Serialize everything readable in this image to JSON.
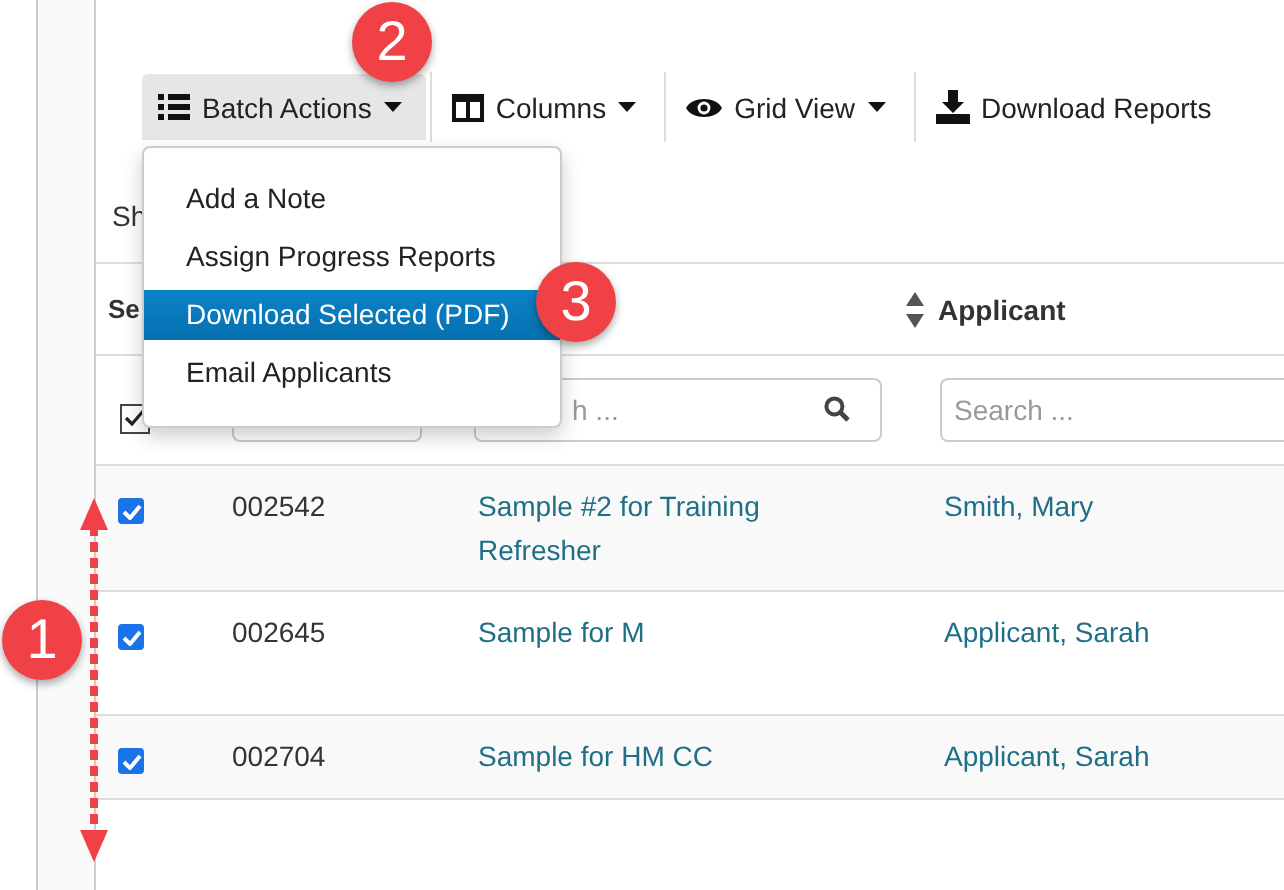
{
  "toolbar": {
    "buttons": [
      {
        "kind": "list",
        "label": "Batch Actions",
        "dropdown": true,
        "selected": true
      },
      {
        "kind": "columns",
        "label": "Columns",
        "dropdown": true,
        "selected": false
      },
      {
        "kind": "eye",
        "label": "Grid View",
        "dropdown": true,
        "selected": false
      },
      {
        "kind": "download",
        "label": "Download Reports",
        "dropdown": false,
        "selected": false
      }
    ]
  },
  "dropdown_menu": {
    "items": [
      {
        "label": "Add a Note",
        "selected": false
      },
      {
        "label": "Assign Progress Reports",
        "selected": false
      },
      {
        "label": "Download Selected (PDF)",
        "selected": true
      },
      {
        "label": "Email Applicants",
        "selected": false
      }
    ]
  },
  "info_text": "Sh",
  "table": {
    "header_select": "Se",
    "header_applicant": "Applicant",
    "filters": {
      "select_all_checked": true,
      "title_search_placeholder": "h ...",
      "applicant_search_placeholder": "Search ..."
    },
    "rows": [
      {
        "checked": true,
        "id": "002542",
        "title": "Sample #2 for Training Refresher",
        "applicant": "Smith, Mary"
      },
      {
        "checked": true,
        "id": "002645",
        "title": "Sample for M",
        "applicant": "Applicant, Sarah"
      },
      {
        "checked": true,
        "id": "002704",
        "title": "Sample for HM CC",
        "applicant": "Applicant, Sarah"
      }
    ]
  },
  "annotations": [
    {
      "label": "2"
    },
    {
      "label": "3"
    },
    {
      "label": "1"
    }
  ]
}
